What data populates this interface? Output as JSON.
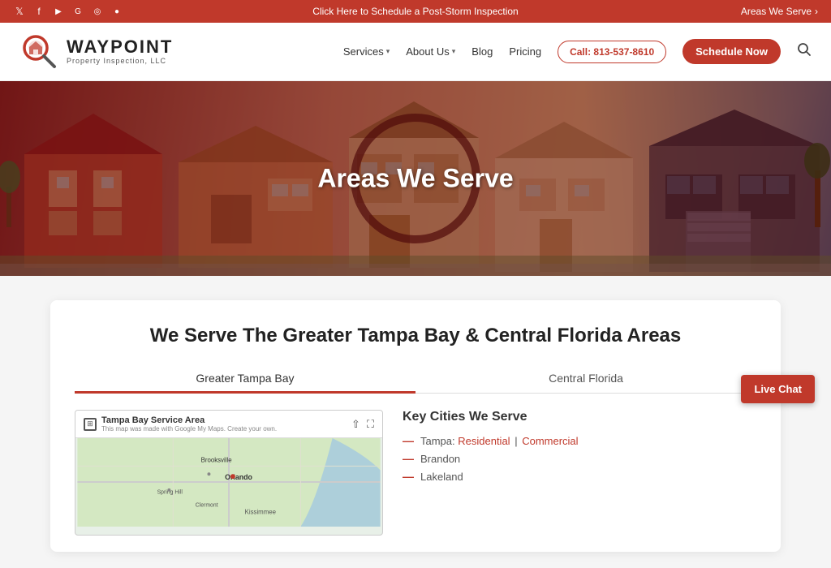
{
  "topbar": {
    "announcement": "Click Here to Schedule a Post-Storm Inspection",
    "areas_we_serve": "Areas We Serve",
    "chevron": "›"
  },
  "header": {
    "logo_title": "WAYPOINT",
    "logo_subtitle": "Property Inspection, LLC",
    "nav": [
      {
        "label": "Services",
        "has_dropdown": true
      },
      {
        "label": "About Us",
        "has_dropdown": true
      },
      {
        "label": "Blog",
        "has_dropdown": false
      },
      {
        "label": "Pricing",
        "has_dropdown": false
      }
    ],
    "call_btn": "Call: 813-537-8610",
    "schedule_btn": "Schedule Now"
  },
  "hero": {
    "title": "Areas We Serve"
  },
  "content": {
    "main_title": "We Serve The Greater Tampa Bay & Central Florida Areas",
    "tabs": [
      {
        "label": "Greater Tampa Bay",
        "active": true
      },
      {
        "label": "Central Florida",
        "active": false
      }
    ],
    "map": {
      "title": "Tampa Bay Service Area",
      "subtitle": "This map was made with Google My Maps. Create your own.",
      "label_orlando": "Orlando",
      "label_brooksville": "Brooksville",
      "label_kissimmee": "Kissimmee",
      "label_spring_hill": "Spring Hill",
      "label_clemont": "Clermont"
    },
    "cities_section": {
      "title": "Key Cities We Serve",
      "cities": [
        {
          "name": "Tampa",
          "links": [
            "Residential",
            "Commercial"
          ],
          "separator": "|"
        },
        {
          "name": "Brandon"
        },
        {
          "name": "Lakeland"
        }
      ]
    }
  },
  "live_chat": {
    "label": "Live Chat"
  },
  "social_icons": [
    "𝕏",
    "f",
    "▶",
    "G+",
    "📷",
    "●"
  ]
}
